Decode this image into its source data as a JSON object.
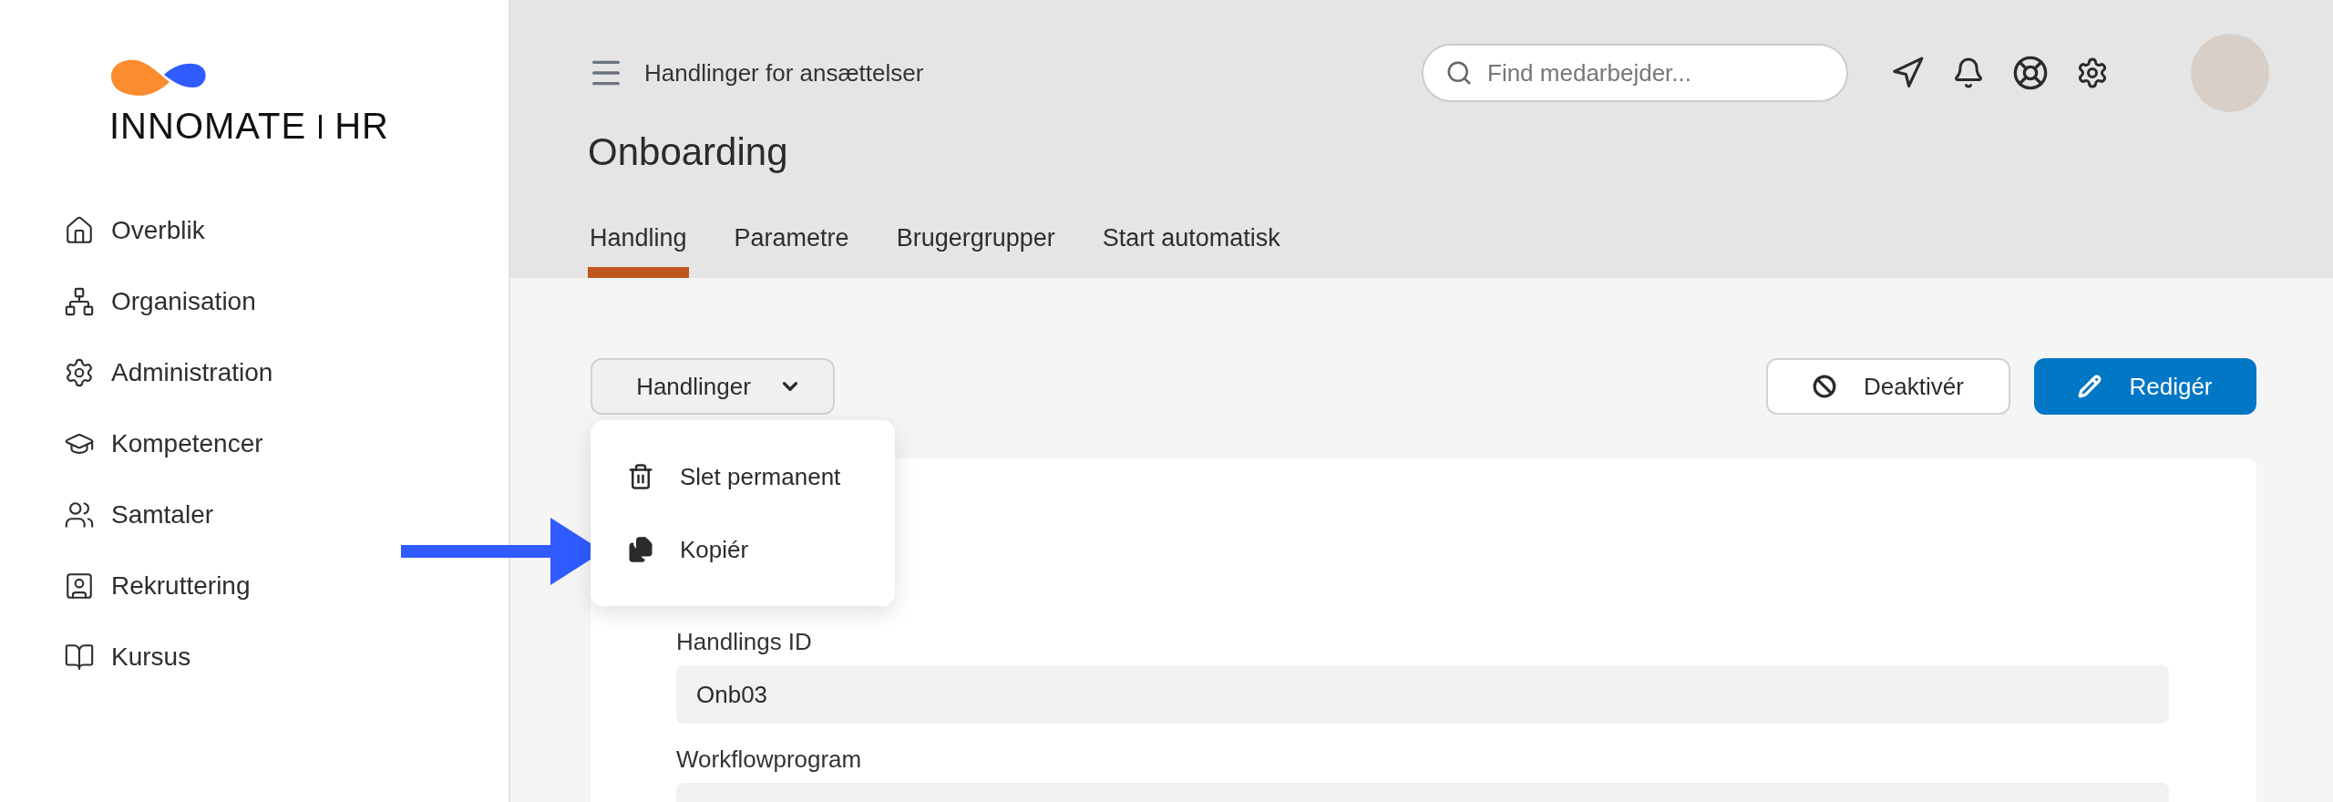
{
  "logo": {
    "brand": "INNO**MATE**",
    "product": "HR"
  },
  "sidebar": {
    "items": [
      {
        "label": "Overblik"
      },
      {
        "label": "Organisation"
      },
      {
        "label": "Administration"
      },
      {
        "label": "Kompetencer"
      },
      {
        "label": "Samtaler"
      },
      {
        "label": "Rekruttering"
      },
      {
        "label": "Kursus"
      }
    ]
  },
  "header": {
    "breadcrumb": "Handlinger for ansættelser",
    "search": {
      "placeholder": "Find medarbejder..."
    },
    "title": "Onboarding",
    "tabs": [
      {
        "label": "Handling",
        "selected": true
      },
      {
        "label": "Parametre",
        "selected": false
      },
      {
        "label": "Brugergrupper",
        "selected": false
      },
      {
        "label": "Start automatisk",
        "selected": false
      }
    ]
  },
  "actions": {
    "dropdown": {
      "label": "Handlinger",
      "expanded": true,
      "items": [
        {
          "label": "Slet permanent",
          "kind": "delete"
        },
        {
          "label": "Kopiér",
          "kind": "copy"
        }
      ]
    },
    "buttons": [
      {
        "label": "Deaktivér",
        "kind": "deactivate"
      },
      {
        "label": "Redigér",
        "kind": "edit"
      }
    ]
  },
  "form": {
    "fields": [
      {
        "label": "Handlings ID",
        "value": "Onb03"
      },
      {
        "label": "Workflowprogram"
      }
    ]
  }
}
